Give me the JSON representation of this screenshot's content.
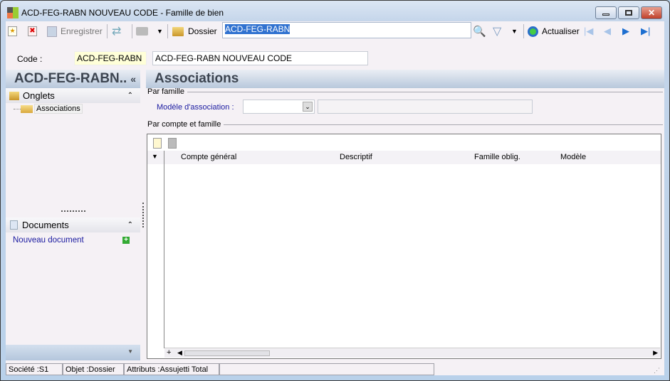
{
  "window": {
    "title": "ACD-FEG-RABN NOUVEAU CODE -  Famille de bien"
  },
  "toolbar": {
    "save_label": "Enregistrer",
    "folder_label": "Dossier",
    "search_value": "ACD-FEG-RABN",
    "refresh_label": "Actualiser"
  },
  "code": {
    "label": "Code :",
    "value": "ACD-FEG-RABN",
    "description": "ACD-FEG-RABN NOUVEAU CODE"
  },
  "left": {
    "title": "ACD-FEG-RABN..",
    "tabs_header": "Onglets",
    "tab_items": [
      "Associations"
    ],
    "documents_header": "Documents",
    "new_document": "Nouveau document"
  },
  "main": {
    "title": "Associations",
    "group1": "Par famille",
    "model_label": "Modèle d'association :",
    "model_value": "",
    "model_desc": "",
    "group2": "Par compte et famille",
    "columns": [
      "Compte général",
      "Descriptif",
      "Famille oblig.",
      "Modèle"
    ],
    "rows": []
  },
  "status": {
    "company": "Société :S1",
    "object": "Objet :Dossier",
    "attributes": "Attributs :Assujetti Total"
  }
}
